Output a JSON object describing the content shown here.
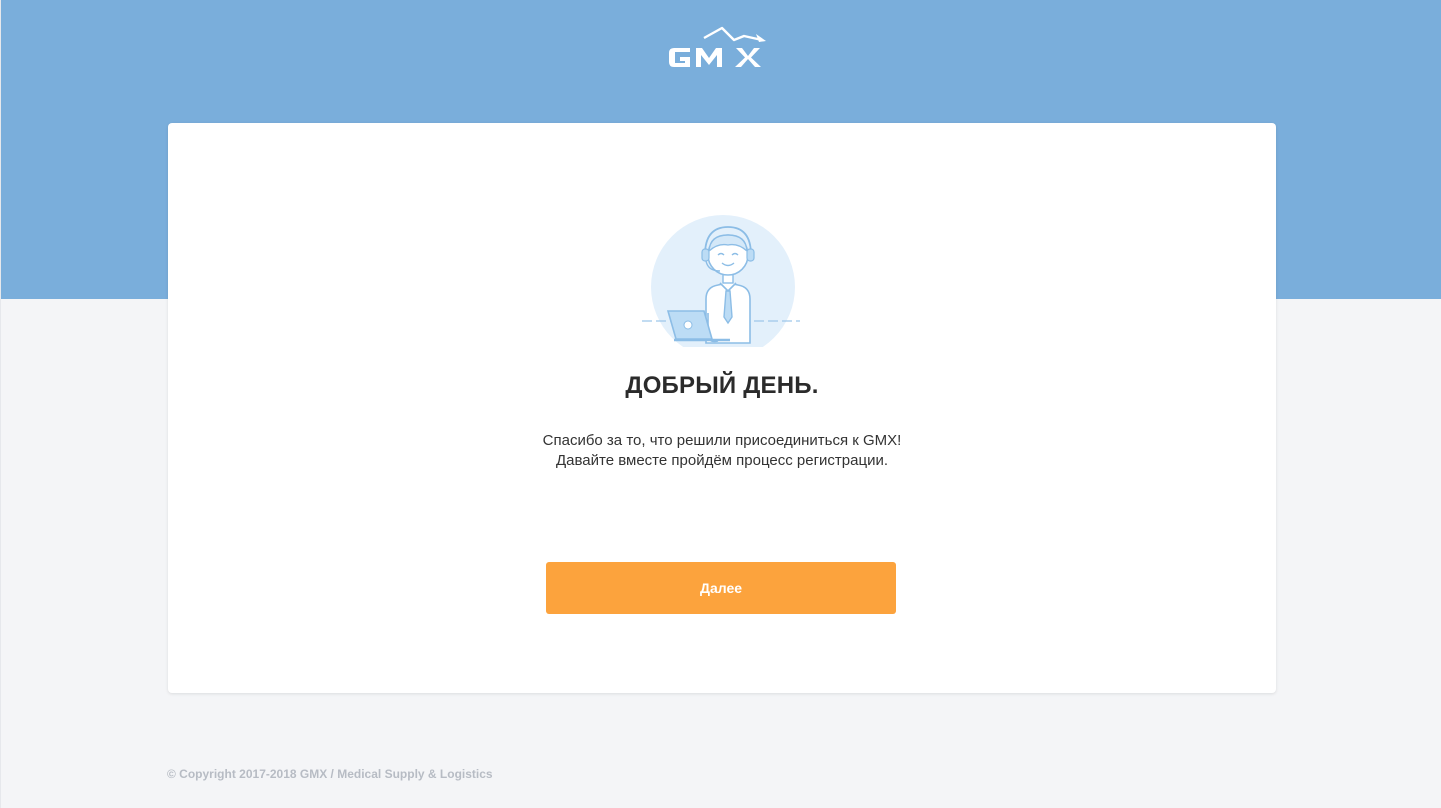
{
  "brand": {
    "logo_text": "GMX",
    "header_color": "#7aaedb",
    "accent_color": "#fca33d"
  },
  "welcome": {
    "illustration_icon": "support-operator-icon",
    "title": "ДОБРЫЙ ДЕНЬ.",
    "line1": "Спасибо за то, что решили присоединиться к GMX!",
    "line2": "Давайте вместе пройдём процесс регистрации.",
    "next_label": "Далее"
  },
  "footer": {
    "copyright": "© Copyright 2017-2018 GMX / Medical Supply & Logistics"
  }
}
